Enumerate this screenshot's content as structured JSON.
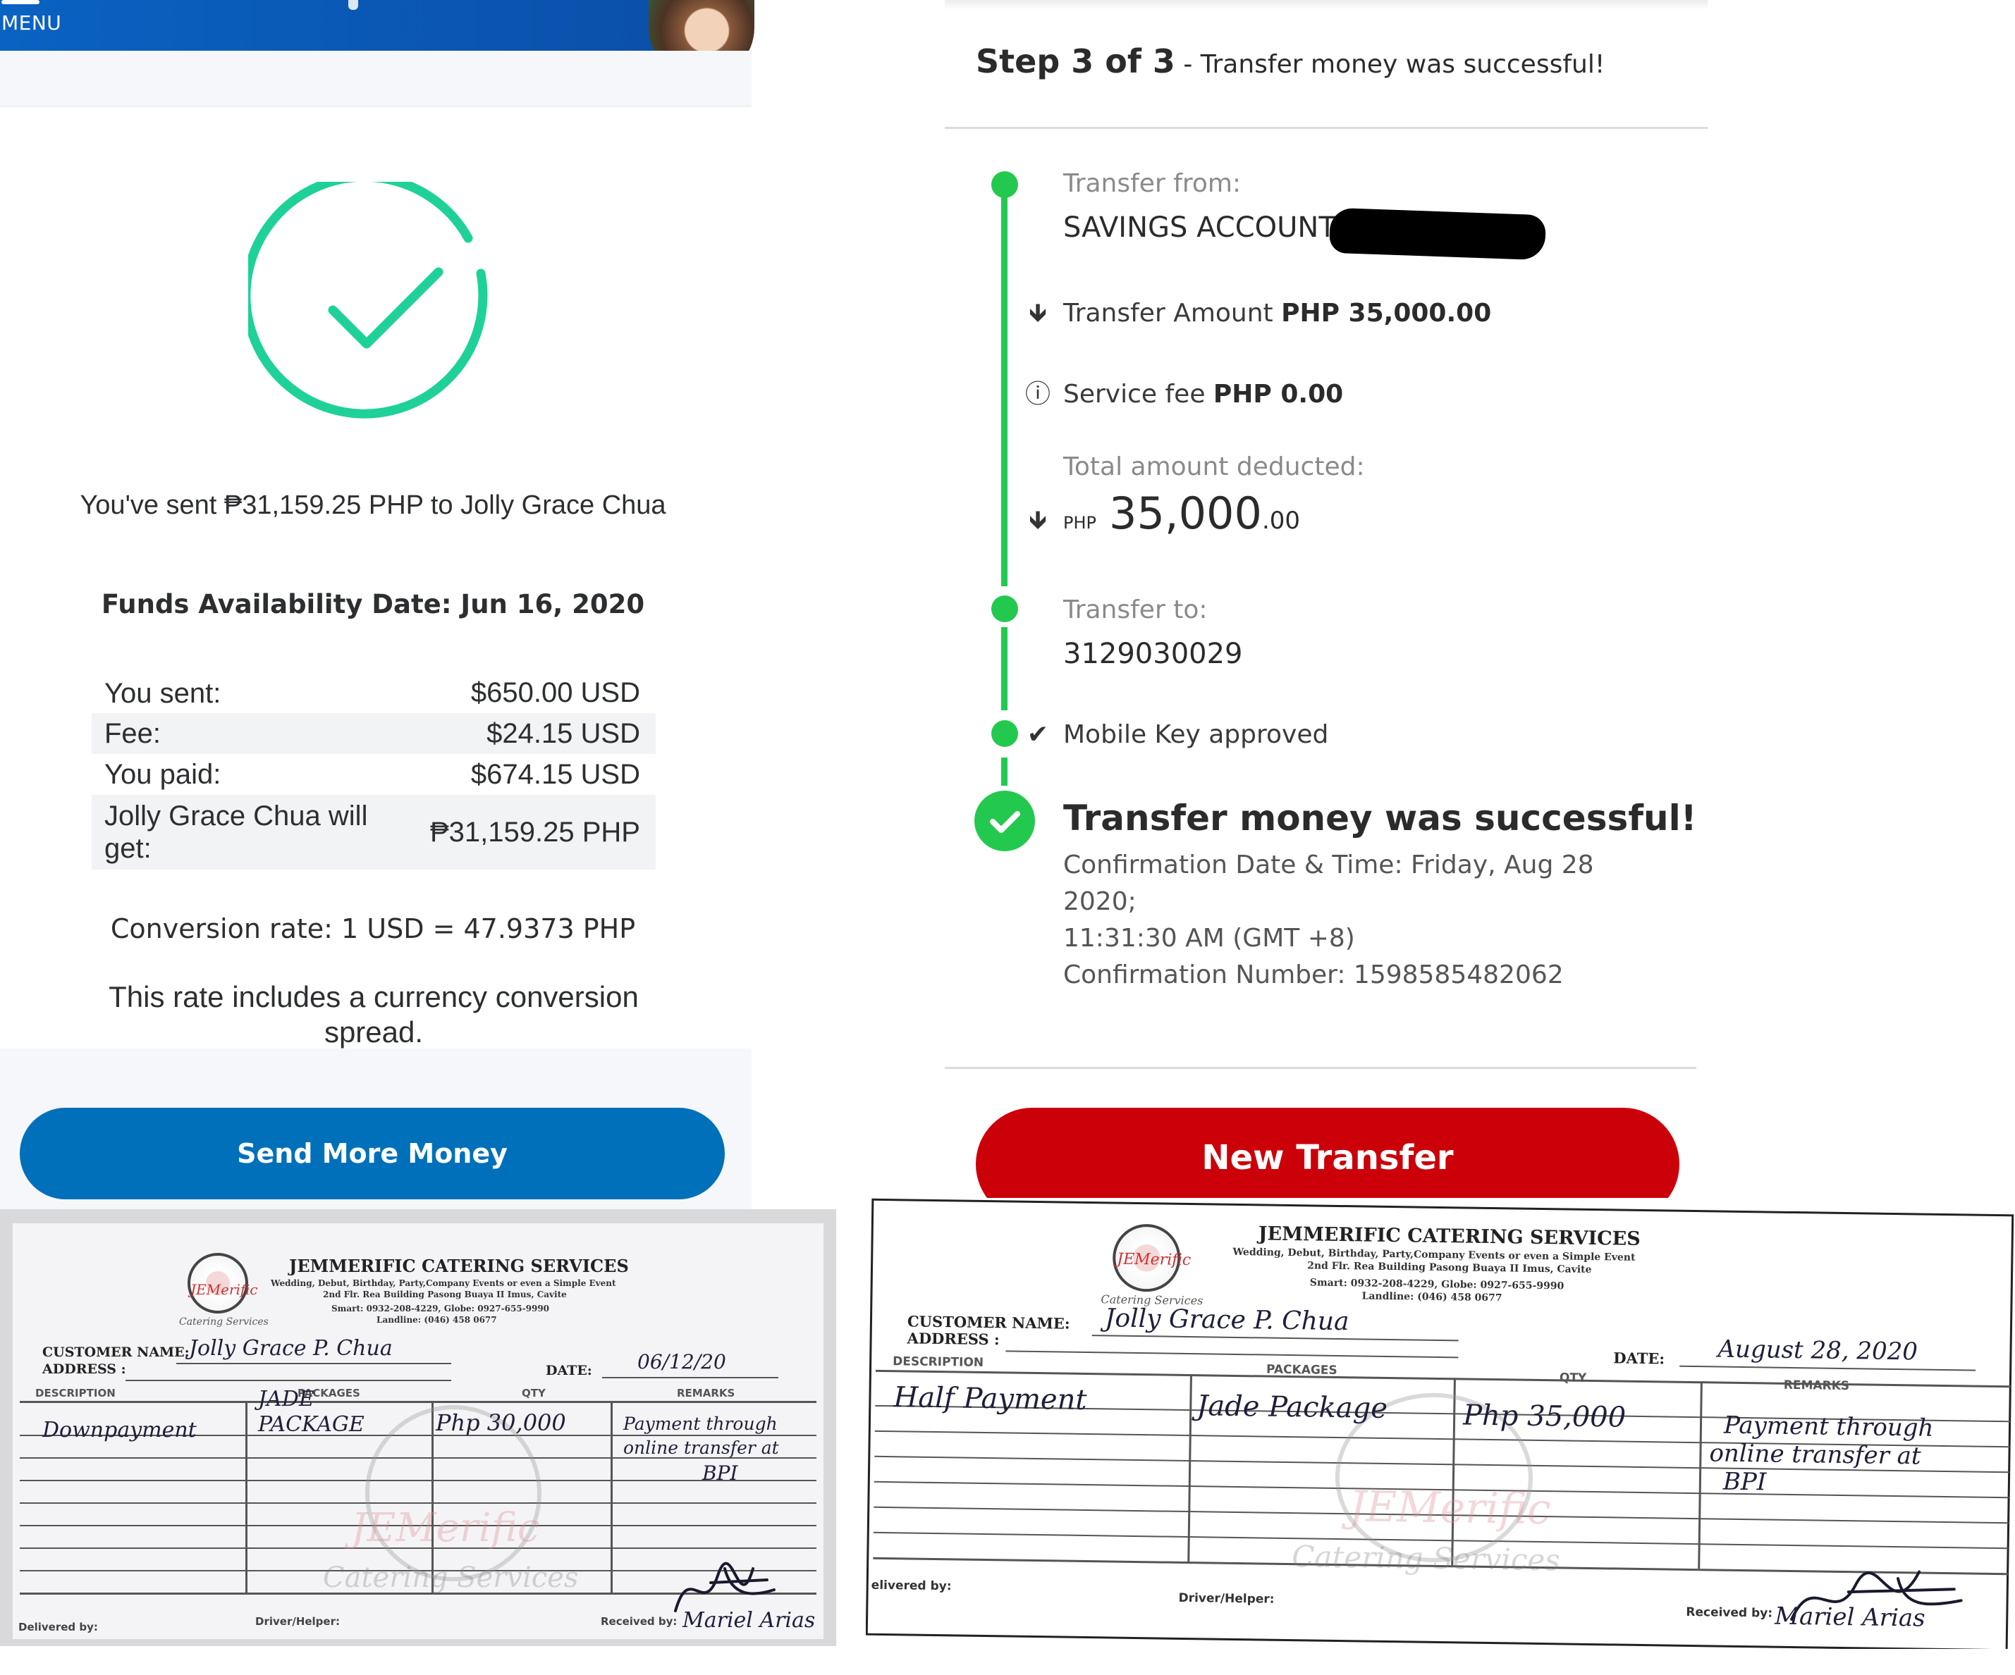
{
  "paypal": {
    "menu_label": "MENU",
    "sent_text": "You've sent ₱31,159.25 PHP to Jolly Grace Chua",
    "funds_availability": "Funds Availability Date: Jun 16, 2020",
    "summary": [
      {
        "label": "You sent:",
        "value": "$650.00 USD"
      },
      {
        "label": "Fee:",
        "value": "$24.15 USD"
      },
      {
        "label": "You paid:",
        "value": "$674.15 USD"
      },
      {
        "label": "Jolly Grace Chua will get:",
        "value": "₱31,159.25 PHP"
      }
    ],
    "conversion_rate": "Conversion rate: 1 USD = 47.9373 PHP",
    "rate_note": "This rate includes a currency conversion spread.",
    "send_more_button": "Send More Money",
    "colors": {
      "success": "#1ed198",
      "button": "#0070ba",
      "header": "#0a62c2"
    }
  },
  "bpi": {
    "step_bold": "Step 3 of 3",
    "step_rest": " - Transfer money was successful!",
    "transfer_from_label": "Transfer from:",
    "transfer_from_value": "SAVINGS ACCOUNT |",
    "transfer_amount_label": "Transfer Amount",
    "transfer_amount_value": "PHP  35,000.00",
    "service_fee_label": "Service fee",
    "service_fee_value": "PHP  0.00",
    "total_label": "Total amount deducted:",
    "total_currency": "PHP",
    "total_whole": "35,000",
    "total_decimal": ".00",
    "transfer_to_label": "Transfer to:",
    "transfer_to_value": "3129030029",
    "mobile_key": "Mobile Key approved",
    "success_title": "Transfer money was successful!",
    "confirmation_line1": "Confirmation Date & Time: Friday, Aug 28 2020;",
    "confirmation_line2": "11:31:30 AM (GMT +8)",
    "confirmation_line3": "Confirmation Number: 1598585482062",
    "new_transfer_button": "New Transfer",
    "colors": {
      "timeline": "#23c94f",
      "button": "#cc0009"
    }
  },
  "receipt_left": {
    "company": "JEMMERIFIC CATERING SERVICES",
    "tagline": "Wedding, Debut, Birthday, Party,Company  Events or even a Simple Event",
    "address_line": "2nd Flr. Rea Building Pasong Buaya II Imus, Cavite",
    "smart": "Smart: 0932-208-4229, Globe: 0927-655-9990",
    "landline": "Landline: (046) 458 0677",
    "customer_label": "CUSTOMER NAME:",
    "customer_value": "Jolly Grace P. Chua",
    "address_label": "ADDRESS :",
    "date_label": "DATE:",
    "date_value": "06/12/20",
    "col_description": "DESCRIPTION",
    "col_packages": "PACKAGES",
    "col_qty": "QTY",
    "col_remarks": "REMARKS",
    "description": "Downpayment",
    "package_line1": "JADE",
    "package_line2": "PACKAGE",
    "qty": "Php 30,000",
    "remarks_line1": "Payment through",
    "remarks_line2": "online transfer at",
    "remarks_line3": "BPI",
    "delivered_by": "Delivered by:",
    "driver_helper": "Driver/Helper:",
    "received_by": "Received by:",
    "receiver_name": "Mariel Arias",
    "logo_text": "JEMerific",
    "logo_sub": "Catering Services"
  },
  "receipt_right": {
    "company": "JEMMERIFIC CATERING SERVICES",
    "tagline": "Wedding, Debut, Birthday, Party,Company  Events or even a Simple Event",
    "address_line": "2nd Flr. Rea Building Pasong Buaya II Imus, Cavite",
    "smart": "Smart: 0932-208-4229, Globe: 0927-655-9990",
    "landline": "Landline: (046) 458 0677",
    "customer_label": "CUSTOMER NAME:",
    "customer_value": "Jolly Grace P. Chua",
    "address_label": "ADDRESS :",
    "date_label": "DATE:",
    "date_value": "August 28, 2020",
    "col_description": "DESCRIPTION",
    "col_packages": "PACKAGES",
    "col_qty": "QTY",
    "col_remarks": "REMARKS",
    "description": "Half Payment",
    "package": "Jade Package",
    "qty": "Php 35,000",
    "remarks_line1": "Payment through",
    "remarks_line2": "online transfer at",
    "remarks_line3": "BPI",
    "delivered_by": "elivered by:",
    "driver_helper": "Driver/Helper:",
    "received_by": "Received by:",
    "receiver_name": "Mariel Arias",
    "logo_text": "JEMerific",
    "logo_sub": "Catering Services"
  }
}
